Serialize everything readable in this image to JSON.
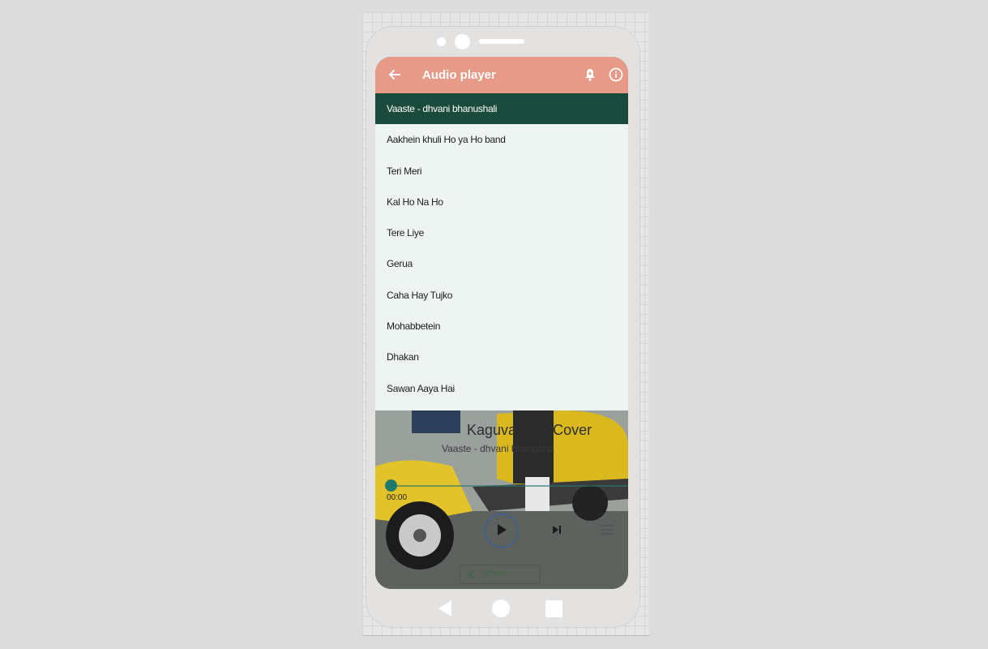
{
  "appbar": {
    "title": "Audio player",
    "back_icon": "arrow-left-icon",
    "bell_icon": "bell-icon",
    "info_icon": "info-icon"
  },
  "playlist": {
    "items": [
      {
        "label": "Vaaste - dhvani bhanushali",
        "active": true
      },
      {
        "label": "Aakhein khuli Ho ya Ho band",
        "active": false
      },
      {
        "label": "Teri Meri",
        "active": false
      },
      {
        "label": "Kal Ho Na Ho",
        "active": false
      },
      {
        "label": "Tere Liye",
        "active": false
      },
      {
        "label": "Gerua",
        "active": false
      },
      {
        "label": "Caha Hay Tujko",
        "active": false
      },
      {
        "label": "Mohabbetein",
        "active": false
      },
      {
        "label": "Dhakan",
        "active": false
      },
      {
        "label": "Sawan Aaya Hai",
        "active": false
      }
    ]
  },
  "player": {
    "title": "Kaguvangan Cover",
    "artist": "Vaaste - dhvani bhanusha",
    "current_time": "00:00",
    "progress": 0,
    "share_label": "Share"
  },
  "colors": {
    "appbar": "#e79a87",
    "active_row": "#1a4a3c",
    "list_bg": "#eef4f1",
    "accent": "#1f7a6a"
  }
}
